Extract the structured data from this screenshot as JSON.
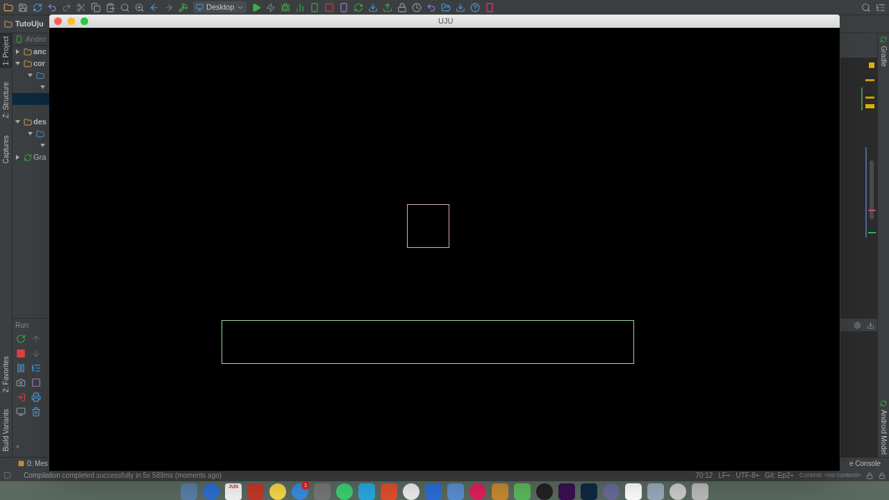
{
  "toolbar": {
    "run_config": "Desktop"
  },
  "nav_tab": "TutoUju",
  "left_stripe": [
    {
      "label": "1: Project",
      "selected": true
    },
    {
      "label": "Z: Structure",
      "selected": false
    },
    {
      "label": "Captures",
      "selected": false
    }
  ],
  "left_stripe_bottom": [
    {
      "label": "2: Favorites",
      "selected": false
    },
    {
      "label": "Build Variants",
      "selected": false
    }
  ],
  "project_header": "Andro",
  "project_tree": [
    {
      "label": "anc",
      "kind": "module",
      "expanded": false,
      "selected": false
    },
    {
      "label": "cor",
      "kind": "module",
      "expanded": true,
      "selected": false,
      "children": [
        {
          "kind": "folder",
          "expanded": true,
          "selected": false,
          "children": [
            {
              "kind": "node",
              "expanded": true,
              "selected": false
            }
          ]
        },
        {
          "kind": "blank",
          "selected": true
        }
      ]
    },
    {
      "label": "des",
      "kind": "module",
      "expanded": true,
      "selected": false,
      "children": [
        {
          "kind": "folder",
          "expanded": true,
          "selected": false,
          "children": [
            {
              "kind": "node",
              "expanded": true,
              "selected": false
            }
          ]
        }
      ]
    },
    {
      "label": "Gra",
      "kind": "gradle",
      "expanded": false,
      "selected": false
    }
  ],
  "run_panel": {
    "label": "Run:",
    "more": "»"
  },
  "bottom_tabs": {
    "left": "0: Mes",
    "right": "e Console"
  },
  "right_stripe": [
    {
      "label": "Gradle"
    },
    {
      "label": "Android Model"
    }
  ],
  "status_bar": {
    "message": "Compilation completed successfully in 5s 589ms (moments ago)",
    "position": "70:12",
    "line_sep": "LF÷",
    "encoding": "UTF-8÷",
    "vcs": "Git: Ep2÷",
    "context": "Context: <no context>"
  },
  "window": {
    "title": "UJU"
  },
  "dock": {
    "calendar": "JUN",
    "badge": "1"
  }
}
